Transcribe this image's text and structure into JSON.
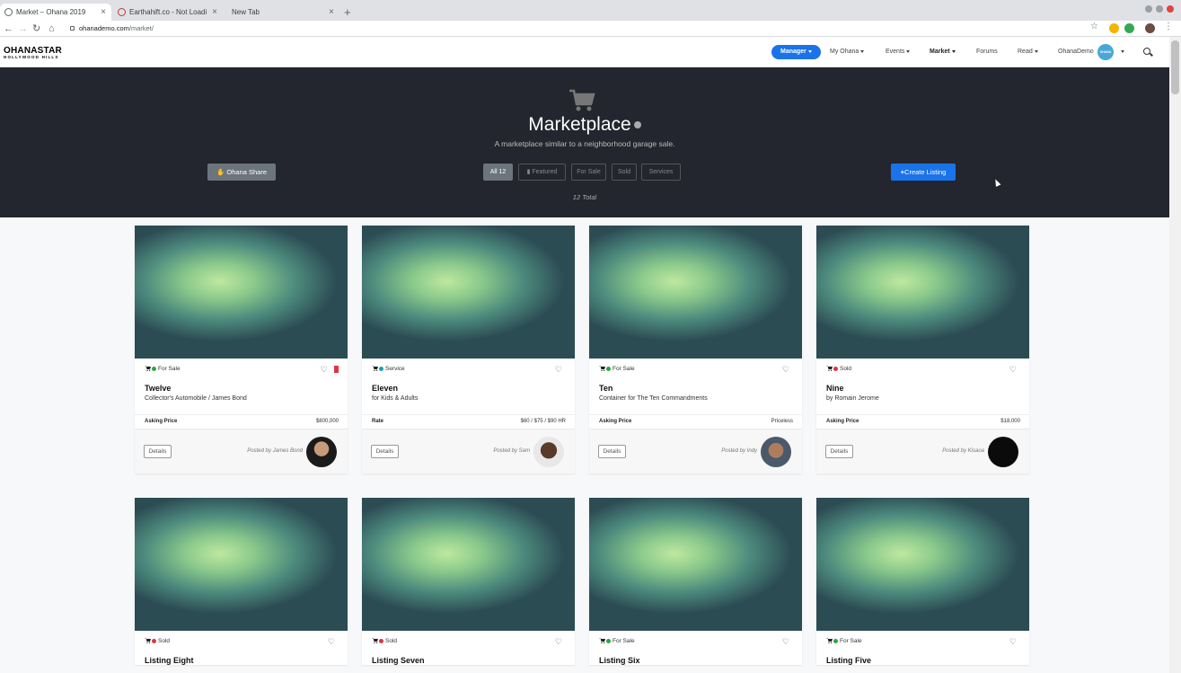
{
  "browser": {
    "tabs": [
      {
        "label": "Market – Ohana 2019",
        "active": true
      },
      {
        "label": "Earthahift.co - Not Loadi",
        "active": false
      },
      {
        "label": "New Tab",
        "active": false
      }
    ],
    "url_host": "ohanademo.com",
    "url_path": "/market/"
  },
  "site": {
    "logo": "OHANASTAR",
    "logo_sub": "HOLLYWOOD HILLS",
    "nav": {
      "manager": "Manager",
      "my_ohana": "My Ohana",
      "events": "Events",
      "market": "Market",
      "forums": "Forums",
      "read": "Read",
      "user": "OhanaDemo",
      "avatar_text": "OHANA STAR"
    }
  },
  "hero": {
    "title": "Marketplace",
    "subtitle": "A marketplace similar to a neighborhood garage sale.",
    "share_button": "Ohana Share",
    "filters": [
      "All 12",
      "Featured",
      "For Sale",
      "Sold",
      "Services"
    ],
    "create_button": "Create Listing",
    "total": "12 Total"
  },
  "colors": {
    "accent": "#1a73e8",
    "hero_bg": "#23262e",
    "for_sale": "#28a745",
    "service": "#17a2b8",
    "sold": "#dc3545"
  },
  "listings": [
    {
      "status": "For Sale",
      "title": "Twelve",
      "subtitle": "Collector's Automobile / James Bond",
      "price_label": "Asking Price",
      "price": "$800,000",
      "posted": "Posted by James Bond",
      "details": "Details",
      "status_color": "#28a745",
      "bookmarked": true
    },
    {
      "status": "Service",
      "title": "Eleven",
      "subtitle": "for Kids & Adults",
      "price_label": "Rate",
      "price": "$60 / $75 / $90 HR",
      "posted": "Posted by Sam",
      "details": "Details",
      "status_color": "#17a2b8"
    },
    {
      "status": "For Sale",
      "title": "Ten",
      "subtitle": "Container for The Ten Commandments",
      "price_label": "Asking Price",
      "price": "Priceless",
      "posted": "Posted by Indy",
      "details": "Details",
      "status_color": "#28a745"
    },
    {
      "status": "Sold",
      "title": "Nine",
      "subtitle": "by Romain Jerome",
      "price_label": "Asking Price",
      "price": "$18,000",
      "posted": "Posted by Kisaoa",
      "details": "Details",
      "status_color": "#dc3545"
    },
    {
      "status": "Sold",
      "title": "Listing Eight",
      "status_color": "#dc3545"
    },
    {
      "status": "Sold",
      "title": "Listing Seven",
      "status_color": "#dc3545"
    },
    {
      "status": "For Sale",
      "title": "Listing Six",
      "status_color": "#28a745"
    },
    {
      "status": "For Sale",
      "title": "Listing Five",
      "status_color": "#28a745"
    }
  ]
}
